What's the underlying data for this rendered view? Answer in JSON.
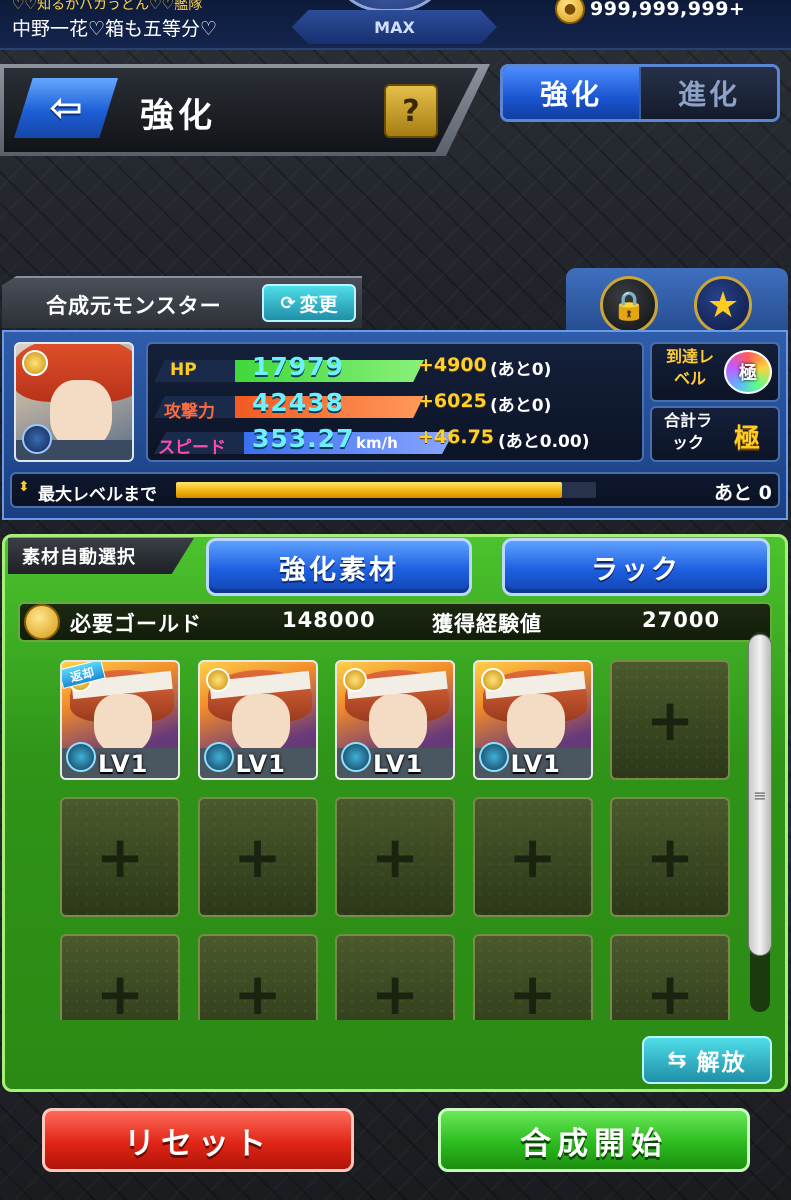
{
  "header": {
    "ticker": "♡♡知るかバカうどん♡♡艦隊",
    "username": "中野一花♡箱も五等分♡",
    "rank": "MAX",
    "gold": "999,999,999+"
  },
  "title": {
    "page_title": "強化",
    "help": "?"
  },
  "tabs": [
    {
      "label": "強化",
      "active": true
    },
    {
      "label": "進化",
      "active": false
    }
  ],
  "monster": {
    "header_label": "合成元モンスター",
    "change_label": "変更",
    "stats": [
      {
        "label": "HP",
        "value": "17979",
        "unit": "",
        "plus": "+4900",
        "remain": "(あと0)",
        "label_color": "#ffcc22",
        "bar": "#3fd83a"
      },
      {
        "label": "攻撃力",
        "value": "42438",
        "unit": "",
        "plus": "+6025",
        "remain": "(あと0)",
        "label_color": "#ff6a3a",
        "bar": "#f25a22"
      },
      {
        "label": "スピード",
        "value": "353.27",
        "unit": "km/h",
        "plus": "+46.75",
        "remain": "(あと0.00)",
        "label_color": "#ff4ab0",
        "bar": "#3a6ff0"
      }
    ],
    "reach_label": "到達レベル",
    "reach_badge": "極",
    "luck_label": "合計ラック",
    "luck_value": "極",
    "max_level_label": "最大レベルまで",
    "max_level_progress": 0.92,
    "max_level_remain": "あと 0"
  },
  "materials": {
    "auto_select": "素材自動選択",
    "button_materials": "強化素材",
    "button_luck": "ラック",
    "gold_label": "必要ゴールド",
    "gold_value": "148000",
    "exp_label": "獲得経験値",
    "exp_value": "27000",
    "slots": [
      {
        "filled": true,
        "lv": "LV1",
        "tag": "返却"
      },
      {
        "filled": true,
        "lv": "LV1"
      },
      {
        "filled": true,
        "lv": "LV1"
      },
      {
        "filled": true,
        "lv": "LV1"
      },
      {
        "filled": false
      },
      {
        "filled": false
      },
      {
        "filled": false
      },
      {
        "filled": false
      },
      {
        "filled": false
      },
      {
        "filled": false
      },
      {
        "filled": false
      },
      {
        "filled": false
      },
      {
        "filled": false
      },
      {
        "filled": false
      },
      {
        "filled": false
      }
    ],
    "release_label": "解放"
  },
  "footer": {
    "reset": "リセット",
    "start": "合成開始"
  }
}
